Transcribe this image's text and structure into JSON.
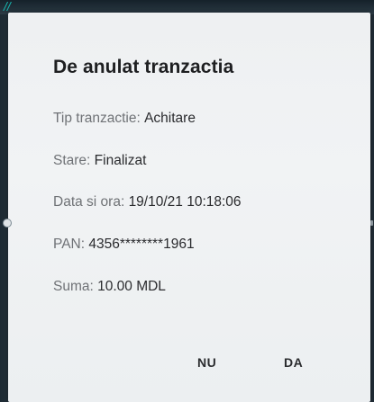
{
  "status_bar": {
    "glyph": "//"
  },
  "dialog": {
    "title": "De anulat tranzactia",
    "fields": [
      {
        "label": "Tip tranzactie: ",
        "value": "Achitare"
      },
      {
        "label": "Stare: ",
        "value": "Finalizat"
      },
      {
        "label": "Data si ora: ",
        "value": "19/10/21 10:18:06"
      },
      {
        "label": "PAN: ",
        "value": "4356********1961"
      },
      {
        "label": "Suma: ",
        "value": "10.00 MDL"
      }
    ],
    "buttons": {
      "no_label": "NU",
      "yes_label": "DA"
    }
  },
  "colors": {
    "accent_teal": "#18b7b0",
    "dialog_bg": "#eef0f2",
    "title_text": "#1e1f21"
  }
}
